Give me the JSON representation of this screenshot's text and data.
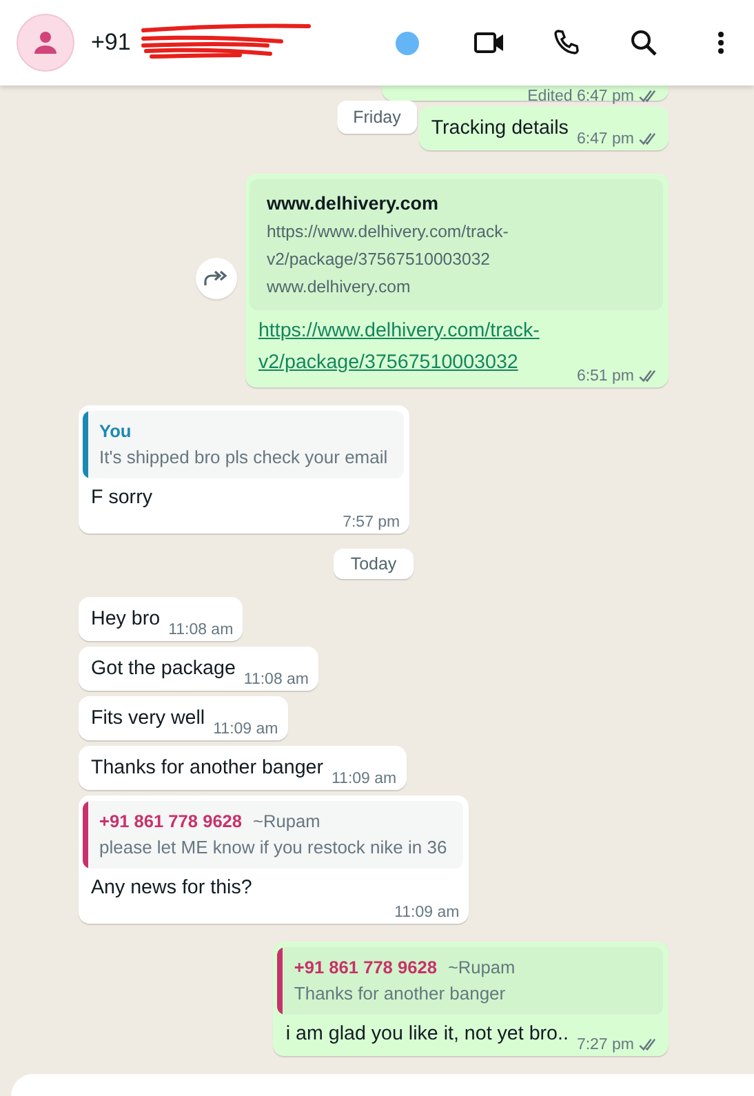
{
  "header": {
    "title": "+91",
    "redacted": true
  },
  "sticky_date": "Friday",
  "messages": [
    {
      "kind": "out",
      "time": "Edited 6:47 pm",
      "read": false
    },
    {
      "kind": "out",
      "text": "Tracking details",
      "time": "6:47 pm",
      "read": false
    },
    {
      "kind": "link",
      "forward": true,
      "preview": {
        "title": "www.delhivery.com",
        "description": "https://www.delhivery.com/track-v2/package/37567510003032",
        "domain": "www.delhivery.com"
      },
      "link": "https://www.delhivery.com/track-v2/package/37567510003032",
      "time": "6:51 pm",
      "read": false
    },
    {
      "kind": "in",
      "quote": {
        "author": "You",
        "color": "#1a8ab3",
        "text": "It's shipped bro pls check your email"
      },
      "text": "F sorry",
      "time": "7:57 pm"
    },
    {
      "kind": "date",
      "text": "Today"
    },
    {
      "kind": "in",
      "text": "Hey bro",
      "time": "11:08 am"
    },
    {
      "kind": "in",
      "text": "Got the package",
      "time": "11:08 am"
    },
    {
      "kind": "in",
      "text": "Fits very well",
      "time": "11:09 am"
    },
    {
      "kind": "in",
      "text": "Thanks for another banger",
      "time": "11:09 am"
    },
    {
      "kind": "in",
      "quote": {
        "author": "+91 861 778 9628",
        "color": "#c8326a",
        "sender": "~Rupam",
        "text": "please let ME know if you restock nike in 36"
      },
      "text": "Any news for this?",
      "time": "11:09 am"
    },
    {
      "kind": "out",
      "quote": {
        "author": "+91 861 778 9628",
        "color": "#c8326a",
        "sender": "~Rupam",
        "text": "Thanks for another banger"
      },
      "text": "i am glad you like it, not yet bro..",
      "time": "7:27 pm",
      "read": false
    }
  ]
}
